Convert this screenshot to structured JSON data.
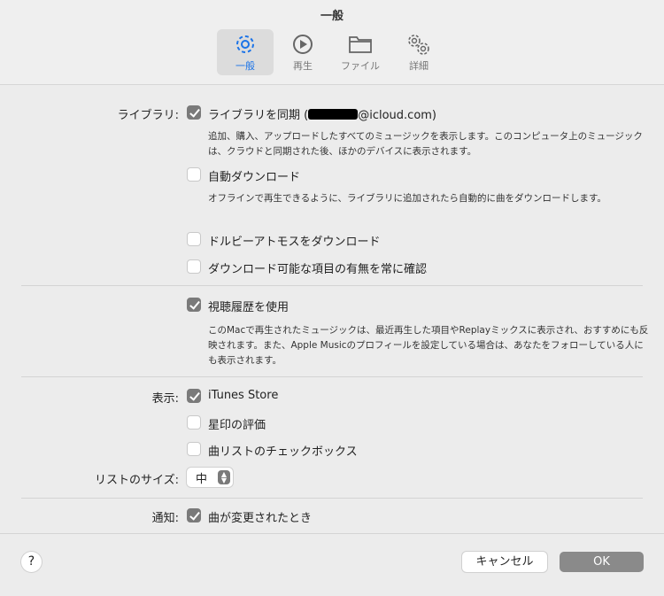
{
  "window": {
    "title": "一般"
  },
  "tabs": [
    {
      "label": "一般",
      "icon": "gear-icon",
      "active": true
    },
    {
      "label": "再生",
      "icon": "play-icon"
    },
    {
      "label": "ファイル",
      "icon": "folder-icon"
    },
    {
      "label": "詳細",
      "icon": "gears-icon"
    }
  ],
  "library": {
    "label": "ライブラリ:",
    "sync": {
      "label_prefix": "ライブラリを同期 (",
      "label_suffix": "@icloud.com)",
      "checked": true,
      "description": "追加、購入、アップロードしたすべてのミュージックを表示します。このコンピュータ上のミュージックは、クラウドと同期された後、ほかのデバイスに表示されます。"
    },
    "auto_download": {
      "label": "自動ダウンロード",
      "checked": false,
      "description": "オフラインで再生できるように、ライブラリに追加されたら自動的に曲をダウンロードします。"
    },
    "dolby": {
      "label": "ドルビーアトモスをダウンロード",
      "checked": false
    },
    "check_downloads": {
      "label": "ダウンロード可能な項目の有無を常に確認",
      "checked": false
    }
  },
  "history": {
    "label": "視聴履歴を使用",
    "checked": true,
    "description": "このMacで再生されたミュージックは、最近再生した項目やReplayミックスに表示され、おすすめにも反映されます。また、Apple Musicのプロフィールを設定している場合は、あなたをフォローしている人にも表示されます。"
  },
  "display": {
    "label": "表示:",
    "items": [
      {
        "label": "iTunes Store",
        "checked": true
      },
      {
        "label": "星印の評価",
        "checked": false
      },
      {
        "label": "曲リストのチェックボックス",
        "checked": false
      }
    ]
  },
  "list_size": {
    "label": "リストのサイズ:",
    "value": "中"
  },
  "notify": {
    "label": "通知:",
    "item": {
      "label": "曲が変更されたとき",
      "checked": true
    }
  },
  "footer": {
    "help": "?",
    "cancel": "キャンセル",
    "ok": "OK"
  },
  "colors": {
    "accent": "#1a73e8",
    "checkbox": "#7a7a7a",
    "ok_button": "#8a8a8a"
  }
}
